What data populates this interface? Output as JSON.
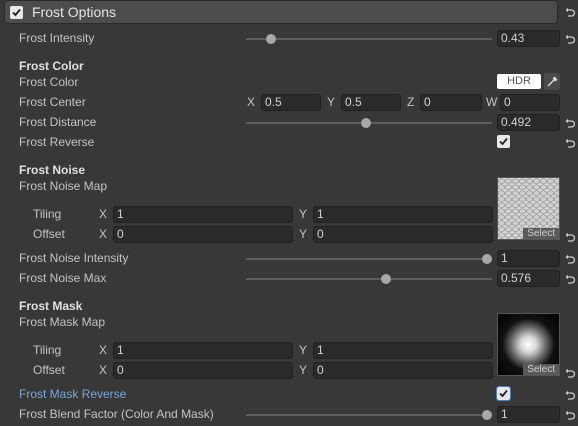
{
  "header": {
    "title": "Frost Options",
    "checked": true
  },
  "rows": {
    "intensity": {
      "label": "Frost Intensity",
      "value": "0.43",
      "fraction": 0.1
    },
    "color_section": "Frost Color",
    "color": {
      "label": "Frost Color",
      "hdr_label": "HDR"
    },
    "center": {
      "label": "Frost Center",
      "x_label": "X",
      "x": "0.5",
      "y_label": "Y",
      "y": "0.5",
      "z_label": "Z",
      "z": "0",
      "w_label": "W",
      "w": "0"
    },
    "distance": {
      "label": "Frost Distance",
      "value": "0.492",
      "fraction": 0.49
    },
    "reverse": {
      "label": "Frost Reverse",
      "checked": true
    },
    "noise_section": "Frost Noise",
    "noise_map": {
      "label": "Frost Noise Map",
      "select_label": "Select"
    },
    "noise_tiling": {
      "label": "Tiling",
      "x_label": "X",
      "x": "1",
      "y_label": "Y",
      "y": "1"
    },
    "noise_offset": {
      "label": "Offset",
      "x_label": "X",
      "x": "0",
      "y_label": "Y",
      "y": "0"
    },
    "noise_intensity": {
      "label": "Frost Noise Intensity",
      "value": "1",
      "fraction": 1.0
    },
    "noise_max": {
      "label": "Frost Noise Max",
      "value": "0.576",
      "fraction": 0.576
    },
    "mask_section": "Frost Mask",
    "mask_map": {
      "label": "Frost Mask Map",
      "select_label": "Select"
    },
    "mask_tiling": {
      "label": "Tiling",
      "x_label": "X",
      "x": "1",
      "y_label": "Y",
      "y": "1"
    },
    "mask_offset": {
      "label": "Offset",
      "x_label": "X",
      "x": "0",
      "y_label": "Y",
      "y": "0"
    },
    "mask_reverse": {
      "label": "Frost Mask Reverse",
      "checked": true
    },
    "blend": {
      "label": "Frost Blend Factor (Color And Mask)",
      "value": "1",
      "fraction": 1.0
    }
  },
  "colors": {
    "panel": "#383838",
    "header": "#4c4c4c",
    "field": "#2a2a2a",
    "link": "#7aa6da"
  },
  "icons": {
    "reset": "reset-arrow-icon",
    "picker": "eyedropper-icon",
    "check": "checkmark-icon"
  }
}
